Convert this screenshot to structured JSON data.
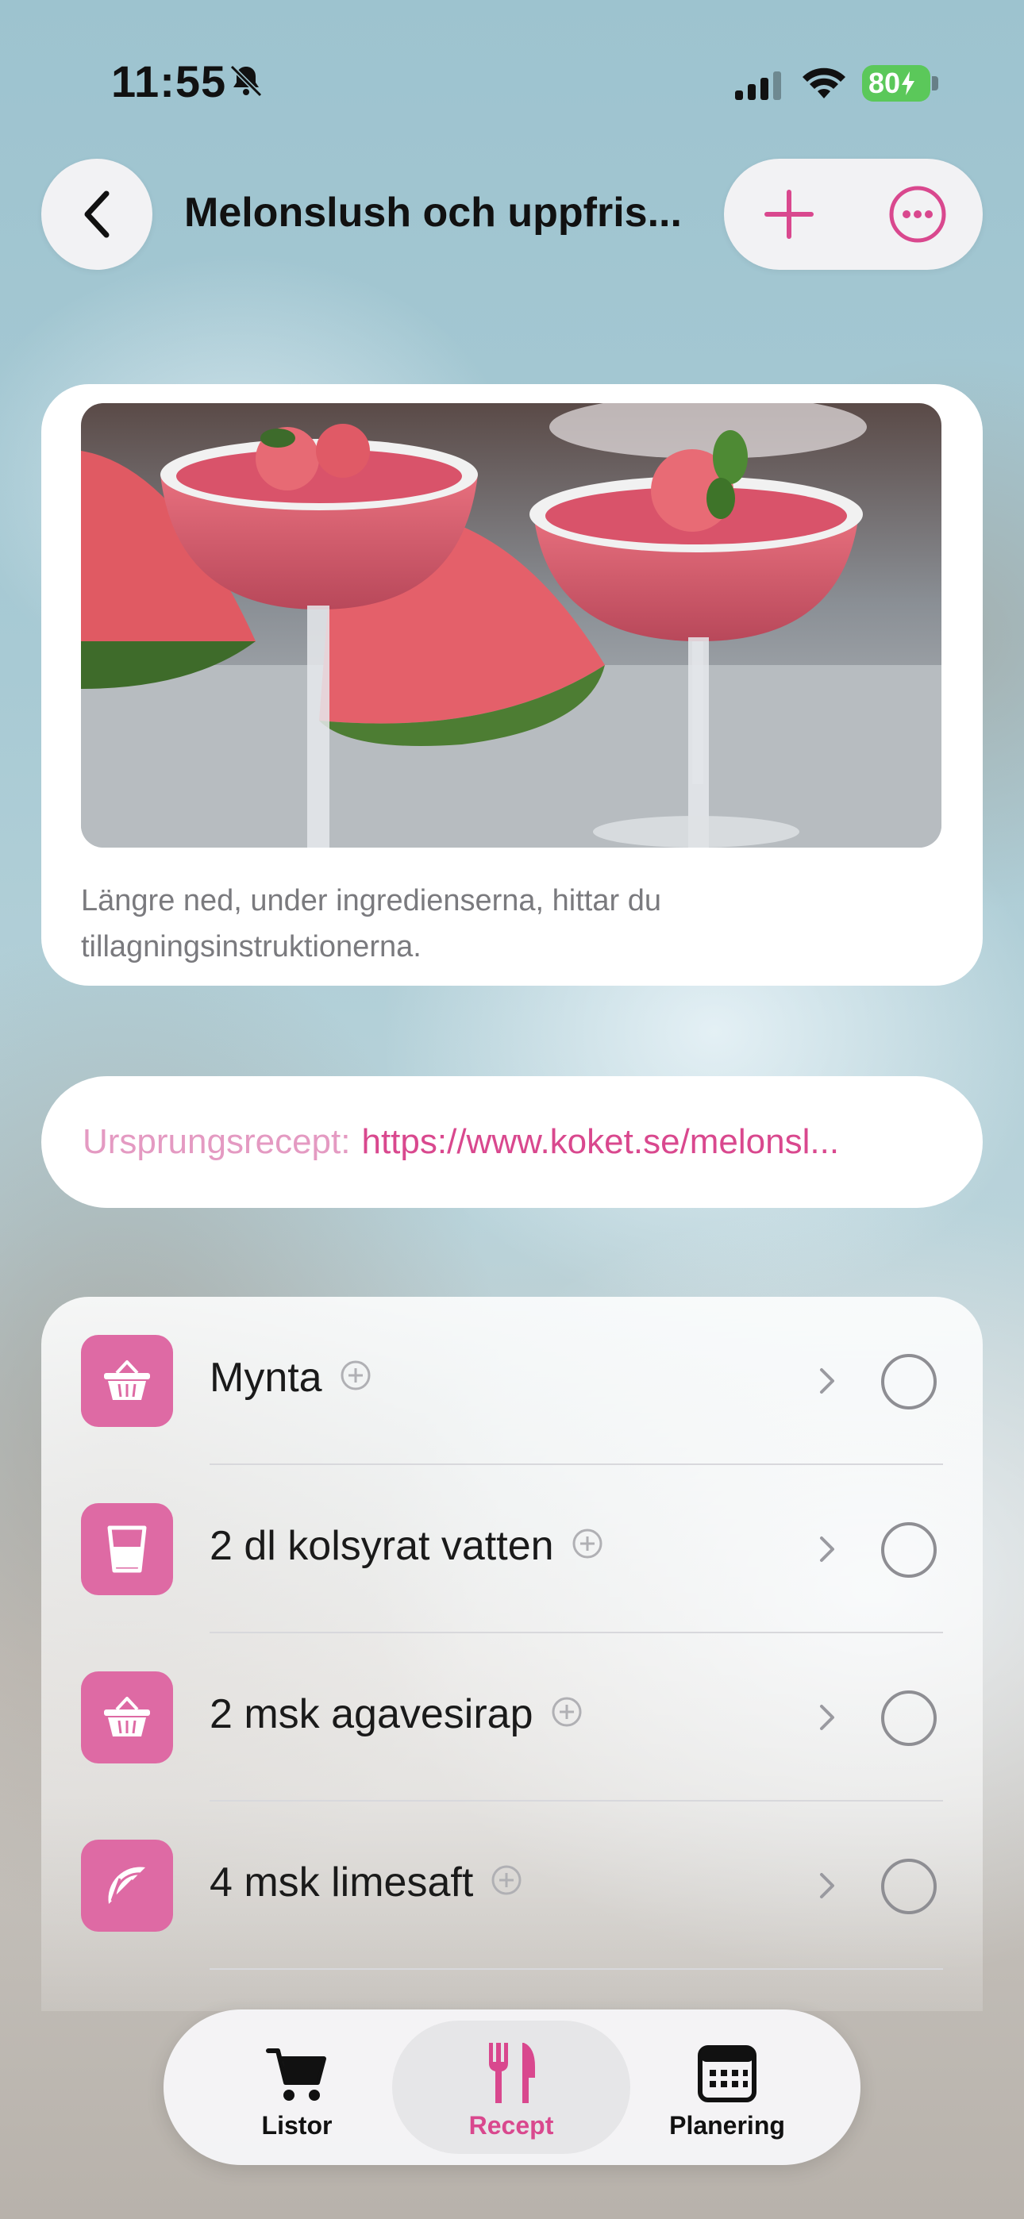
{
  "status_bar": {
    "time": "11:55",
    "battery": "80",
    "icons": [
      "bell-slash-icon",
      "signal-icon",
      "wifi-icon",
      "battery-charging-icon"
    ]
  },
  "nav": {
    "title": "Melonslush och uppfris...",
    "back_icon": "chevron-left-icon",
    "add_icon": "plus-icon",
    "more_icon": "ellipsis-circle-icon"
  },
  "recipe": {
    "photo_alt": "watermelon-slush-cocktail-photo",
    "caption": "Längre ned, under ingredienserna, hittar du tillagningsinstruktionerna.",
    "source_label": "Ursprungsrecept:",
    "source_url": "https://www.koket.se/melonsl..."
  },
  "ingredients": [
    {
      "label": "Mynta",
      "icon": "basket-icon"
    },
    {
      "label": "2 dl kolsyrat vatten",
      "icon": "glass-icon"
    },
    {
      "label": "2 msk agavesirap",
      "icon": "basket-icon"
    },
    {
      "label": "4 msk limesaft",
      "icon": "citrus-slice-icon"
    }
  ],
  "tabs": [
    {
      "label": "Listor",
      "icon": "cart-icon",
      "active": false
    },
    {
      "label": "Recept",
      "icon": "fork-knife-icon",
      "active": true
    },
    {
      "label": "Planering",
      "icon": "calendar-icon",
      "active": false
    }
  ],
  "colors": {
    "accent": "#d9488e",
    "accent_light": "#e49ac2",
    "icon_bg": "#de6aa4"
  }
}
